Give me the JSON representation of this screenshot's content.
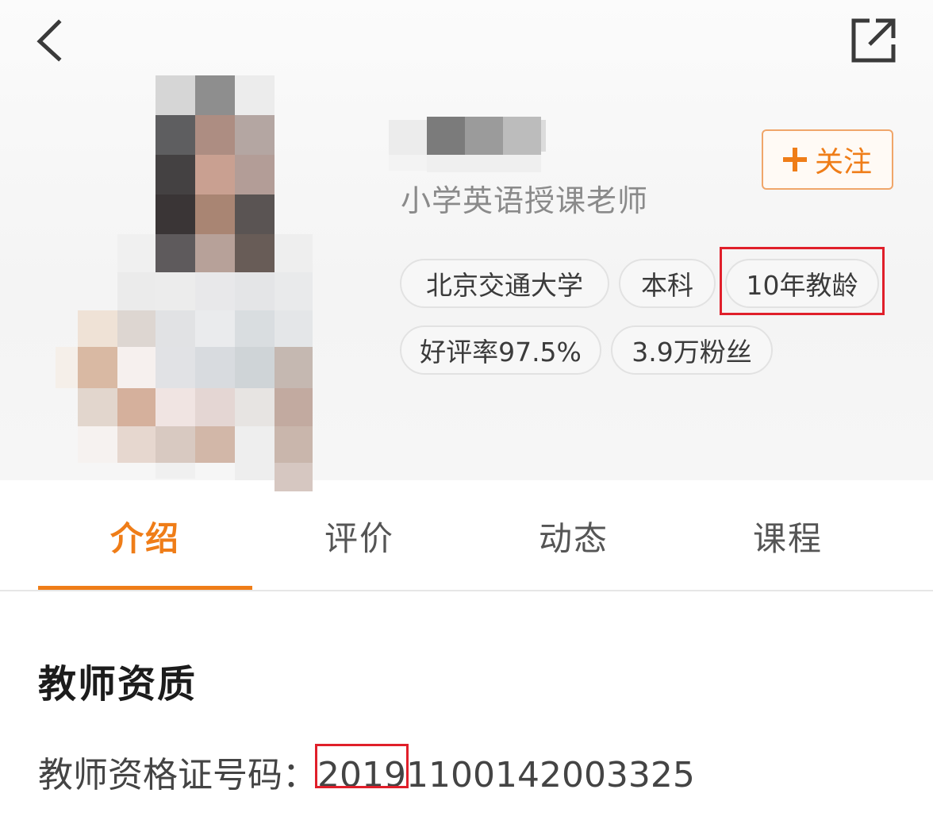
{
  "profile": {
    "title": "小学英语授课老师",
    "follow_label": "关注",
    "tags_row1": [
      "北京交通大学",
      "本科",
      "10年教龄"
    ],
    "tags_row2": [
      "好评率97.5%",
      "3.9万粉丝"
    ]
  },
  "tabs": [
    {
      "label": "介绍",
      "active": true
    },
    {
      "label": "评价",
      "active": false
    },
    {
      "label": "动态",
      "active": false
    },
    {
      "label": "课程",
      "active": false
    }
  ],
  "section": {
    "title": "教师资质",
    "cert_label": "教师资格证号码：",
    "cert_number_highlighted": "2019",
    "cert_number_rest": "1100142003325"
  },
  "colors": {
    "accent": "#ef7d18",
    "highlight": "#e01f2a"
  },
  "icons": {
    "back": "chevron-left-icon",
    "share": "share-external-icon",
    "follow": "plus-icon"
  }
}
